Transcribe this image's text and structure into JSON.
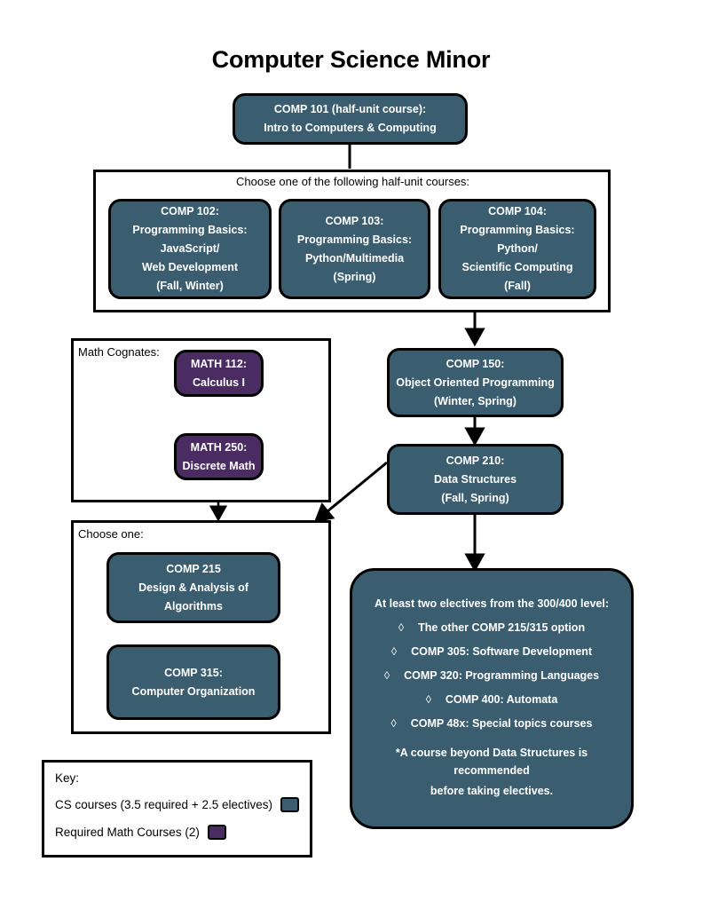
{
  "page": {
    "title": "Computer Science Minor",
    "colors": {
      "cs_course": "#3a5e70",
      "math_course": "#4a2c63",
      "outline": "#000000",
      "background": "#ffffff"
    }
  },
  "intro_course": {
    "line1": "COMP 101 (half-unit course):",
    "line2": "Intro to Computers & Computing"
  },
  "half_unit_group": {
    "label": "Choose one of the following half-unit courses:",
    "courses": [
      {
        "lines": [
          "COMP 102:",
          "Programming Basics:",
          "JavaScript/",
          "Web Development",
          "(Fall, Winter)"
        ]
      },
      {
        "lines": [
          "COMP 103:",
          "Programming Basics:",
          "Python/Multimedia",
          "(Spring)"
        ]
      },
      {
        "lines": [
          "COMP 104:",
          "Programming Basics:",
          "Python/",
          "Scientific Computing",
          "(Fall)"
        ]
      }
    ]
  },
  "math_group": {
    "label": "Math Cognates:",
    "courses": [
      {
        "lines": [
          "MATH 112:",
          "Calculus I"
        ]
      },
      {
        "lines": [
          "MATH 250:",
          "Discrete Math"
        ]
      }
    ]
  },
  "core_sequence": [
    {
      "lines": [
        "COMP 150:",
        "Object Oriented Programming",
        "(Winter, Spring)"
      ]
    },
    {
      "lines": [
        "COMP 210:",
        "Data Structures",
        "(Fall, Spring)"
      ]
    }
  ],
  "choose_one_group": {
    "label": "Choose one:",
    "courses": [
      {
        "lines": [
          "COMP 215",
          "Design & Analysis of",
          "Algorithms"
        ]
      },
      {
        "lines": [
          "COMP 315:",
          "Computer Organization"
        ]
      }
    ]
  },
  "electives": {
    "heading": "At least two electives from the 300/400 level:",
    "bullet_glyph": "◊",
    "items": [
      "The other COMP 215/315 option",
      "COMP 305: Software Development",
      "COMP 320: Programming Languages",
      "COMP 400: Automata",
      "COMP 48x: Special topics courses"
    ],
    "note_line1": "*A course beyond Data Structures is recommended",
    "note_line2": "before taking electives."
  },
  "key": {
    "title": "Key:",
    "entries": [
      {
        "label": "CS courses (3.5 required + 2.5 electives)",
        "swatch": "cs_course"
      },
      {
        "label": "Required Math Courses (2)",
        "swatch": "math_course"
      }
    ]
  }
}
